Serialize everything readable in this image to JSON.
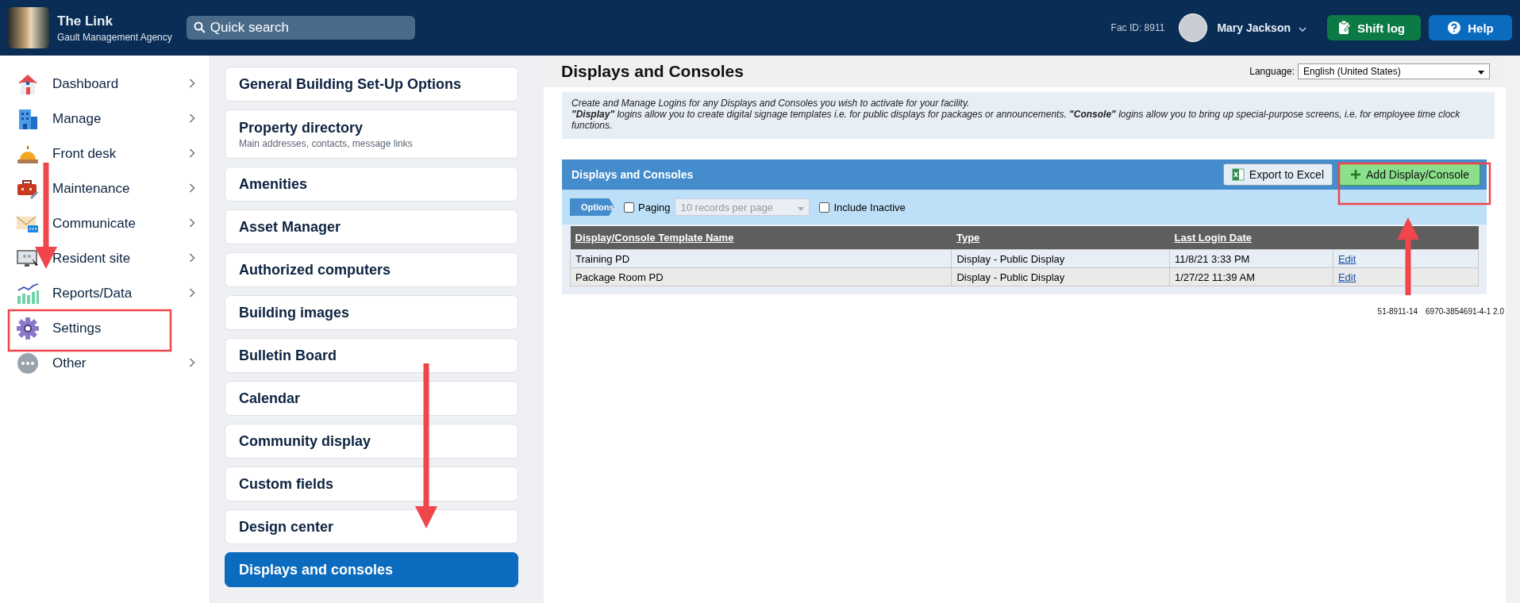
{
  "header": {
    "title": "The Link",
    "subtitle": "Gault Management Agency",
    "search": {
      "placeholder": "Quick search"
    },
    "fac_id": "Fac ID: 8911",
    "user": "Mary Jackson",
    "buttons": [
      {
        "label": "Shift log",
        "kind": "shift"
      },
      {
        "label": "Help",
        "kind": "help"
      }
    ]
  },
  "sidebar": {
    "items": [
      {
        "label": "Dashboard",
        "kind": "house",
        "chevron": true
      },
      {
        "label": "Manage",
        "kind": "building",
        "chevron": true
      },
      {
        "label": "Front desk",
        "kind": "bell",
        "chevron": true
      },
      {
        "label": "Maintenance",
        "kind": "toolbox",
        "chevron": true
      },
      {
        "label": "Communicate",
        "kind": "mail",
        "chevron": true
      },
      {
        "label": "Resident site",
        "kind": "monitor",
        "chevron": true
      },
      {
        "label": "Reports/Data",
        "kind": "chart",
        "chevron": true
      },
      {
        "label": "Settings",
        "kind": "gear",
        "chevron": false
      },
      {
        "label": "Other",
        "kind": "dots",
        "chevron": true
      }
    ]
  },
  "settings_menu": {
    "items": [
      {
        "title": "General Building Set-Up Options",
        "selected": false
      },
      {
        "title": "Property directory",
        "subtitle": "Main addresses, contacts, message links",
        "selected": false
      },
      {
        "title": "Amenities",
        "selected": false
      },
      {
        "title": "Asset Manager",
        "selected": false
      },
      {
        "title": "Authorized computers",
        "selected": false
      },
      {
        "title": "Building images",
        "selected": false
      },
      {
        "title": "Bulletin Board",
        "selected": false
      },
      {
        "title": "Calendar",
        "selected": false
      },
      {
        "title": "Community display",
        "selected": false
      },
      {
        "title": "Custom fields",
        "selected": false
      },
      {
        "title": "Design center",
        "selected": false
      },
      {
        "title": "Displays and consoles",
        "selected": true
      }
    ]
  },
  "content": {
    "title": "Displays and Consoles",
    "language": {
      "label": "Language:",
      "value": "English (United States)"
    },
    "info": [
      "Create and Manage Logins for any Displays and Consoles you wish to activate for your facility.",
      "**\"Display\"** logins allow you to create digital signage templates i.e. for public displays for packages or announcements. **\"Console\"** logins allow you to bring up special-purpose screens, i.e. for employee time clock functions."
    ],
    "grid": {
      "title": "Displays and Consoles",
      "buttons": [
        {
          "label": "Export to Excel",
          "kind": "excel"
        },
        {
          "label": "Add Display/Console",
          "kind": "add"
        }
      ],
      "options": {
        "label": "Options",
        "paging": {
          "label": "Paging",
          "checked": false
        },
        "page_size": {
          "value": "10 records per page",
          "disabled": true
        },
        "include_inactive": {
          "label": "Include Inactive",
          "checked": false
        }
      },
      "table": {
        "columns": [
          "Display/Console Template Name",
          "Type",
          "Last Login Date"
        ],
        "rows": [
          {
            "cells": [
              "Training PD",
              "Display - Public Display",
              "11/8/21 3:33 PM"
            ],
            "action": "Edit"
          },
          {
            "cells": [
              "Package Room PD",
              "Display - Public Display",
              "1/27/22 11:39 AM"
            ],
            "action": "Edit"
          }
        ]
      }
    },
    "footer": [
      "51-8911-14",
      "6970-3854691-4-1 2.0"
    ]
  }
}
